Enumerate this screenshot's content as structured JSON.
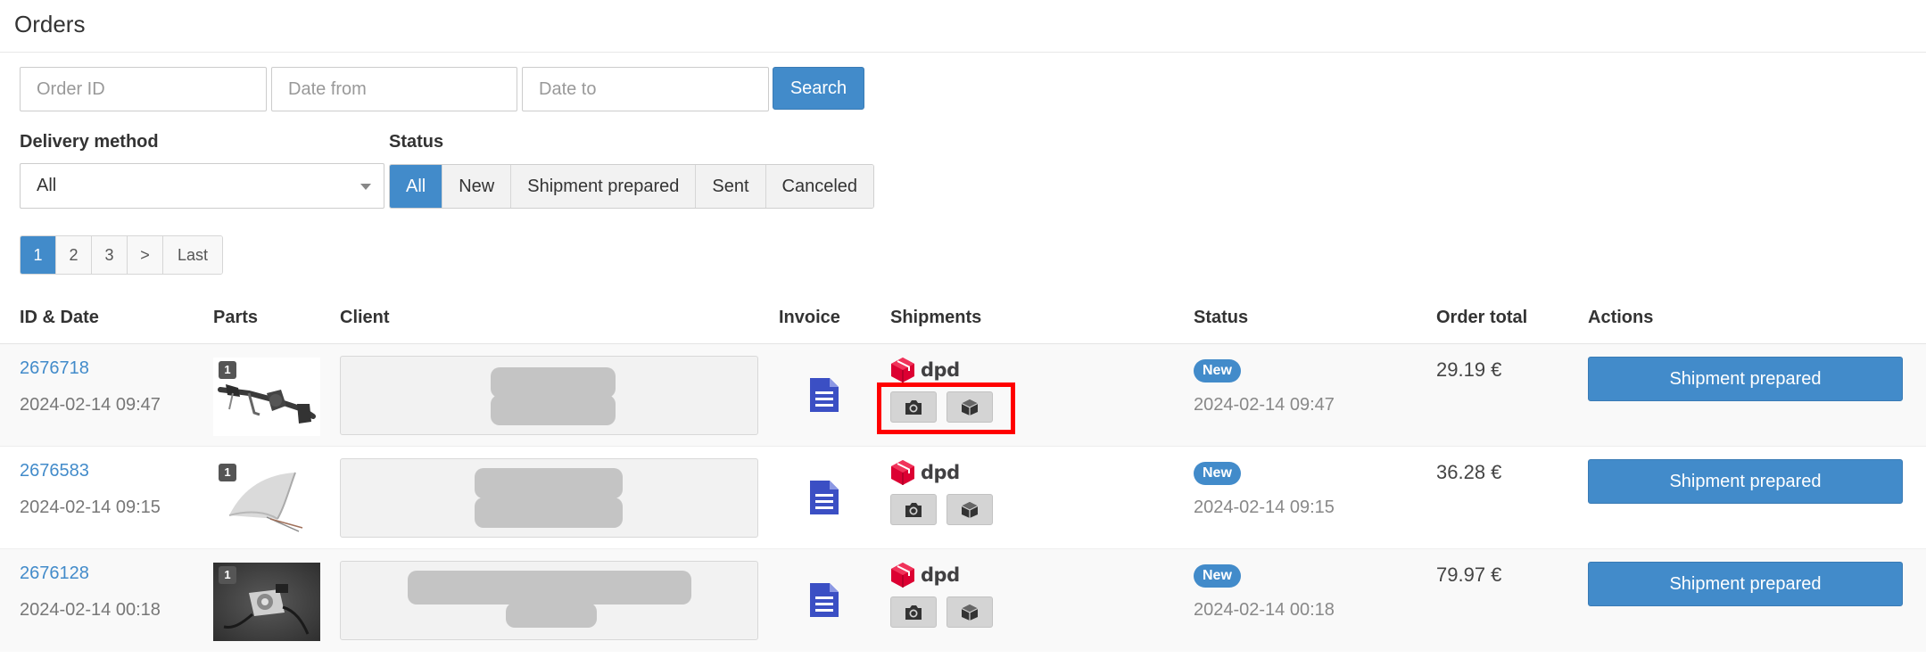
{
  "header": {
    "title": "Orders"
  },
  "search": {
    "order_id_placeholder": "Order ID",
    "date_from_placeholder": "Date from",
    "date_to_placeholder": "Date to",
    "button_label": "Search"
  },
  "filters": {
    "delivery_label": "Delivery method",
    "delivery_value": "All",
    "status_label": "Status",
    "status_options": [
      "All",
      "New",
      "Shipment prepared",
      "Sent",
      "Canceled"
    ],
    "status_active": "All"
  },
  "pagination": {
    "items": [
      "1",
      "2",
      "3",
      ">",
      "Last"
    ],
    "current": "1"
  },
  "table": {
    "columns": [
      "ID & Date",
      "Parts",
      "Client",
      "Invoice",
      "Shipments",
      "Status",
      "Order total",
      "Actions"
    ],
    "rows": [
      {
        "id": "2676718",
        "date": "2024-02-14 09:47",
        "qty": "1",
        "carrier": "dpd",
        "status": "New",
        "status_date": "2024-02-14 09:47",
        "total": "29.19 €",
        "action": "Shipment prepared"
      },
      {
        "id": "2676583",
        "date": "2024-02-14 09:15",
        "qty": "1",
        "carrier": "dpd",
        "status": "New",
        "status_date": "2024-02-14 09:15",
        "total": "36.28 €",
        "action": "Shipment prepared"
      },
      {
        "id": "2676128",
        "date": "2024-02-14 00:18",
        "qty": "1",
        "carrier": "dpd",
        "status": "New",
        "status_date": "2024-02-14 00:18",
        "total": "79.97 €",
        "action": "Shipment prepared"
      }
    ]
  },
  "icons": {
    "invoice": "document-icon",
    "photo": "camera-icon",
    "package": "package-icon",
    "carrier_logo": "dpd-cube-icon"
  },
  "colors": {
    "primary": "#428bca",
    "invoice_icon": "#3b4fc4",
    "dpd_red": "#dc0032",
    "highlight": "#ff0000"
  }
}
